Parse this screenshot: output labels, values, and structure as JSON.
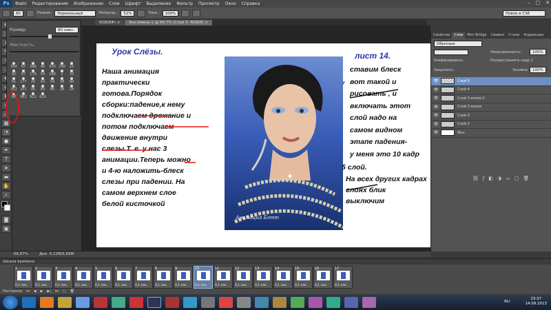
{
  "menubar": {
    "logo": "Ps",
    "items": [
      "Файл",
      "Редактирование",
      "Изображение",
      "Слои",
      "Шрифт",
      "Выделение",
      "Фильтр",
      "Просмотр",
      "Окно",
      "Справка"
    ],
    "win_controls": [
      "–",
      "□",
      "✕"
    ]
  },
  "optbar": {
    "brush_size": "80",
    "mode_label": "Режим:",
    "mode_value": "Нормальный",
    "opacity_label": "Непрозр.:",
    "opacity_value": "52%",
    "flow_label": "Наж.:",
    "flow_value": "100%",
    "workspace": "Новое в CS6"
  },
  "brush_panel": {
    "size_label": "Размер:",
    "size_value": "80 пикс.",
    "hardness_label": "Жесткость:",
    "presets": [
      "354",
      "67",
      "296",
      "46",
      "429",
      "296",
      "15",
      "92",
      "67",
      "179",
      "54",
      "188",
      "1",
      "10",
      "61",
      "177",
      "20",
      "43",
      "54",
      "38",
      "60",
      "352",
      "101",
      "90",
      "83",
      "80",
      "28",
      "24",
      "80",
      "962",
      "912",
      "619"
    ]
  },
  "doc_tabs": [
    {
      "label": "RGB/8#) ×",
      "active": false
    },
    {
      "label": "Без имени-1 @ 66,7% (Слой 5, RGB/8) ×",
      "active": true
    }
  ],
  "canvas": {
    "title": "Урок Слёзы.",
    "left_text": [
      "Наша анимация",
      "практически",
      "готова.Порядок",
      "сборки:падение,к нему",
      "подключаем дрожание и",
      "потом подключаем",
      "движение внутри",
      "слезы.Т. е. у нас 3",
      "анимации.Теперь можно",
      "и 4-ю наложить-блеск",
      "слезы при падении. На",
      "самом верхнем слое",
      "белой кисточкой"
    ],
    "sheet_label": "лист 14.",
    "right_text": [
      "ставим блеск",
      "вот такой и",
      "рисовать , и",
      "включать этот",
      "слой надо на",
      "самом видном",
      "этапе падения-",
      "у меня это 10 кадр"
    ],
    "right_text_2": "5 слой.",
    "right_text_3": [
      "На всех других  кадрах",
      "слоях блик",
      "выключим"
    ],
    "watermark": "Анимация Бэтт"
  },
  "right_panel": {
    "tabs": [
      "Свойства",
      "Слои",
      "Mini Bridge",
      "Символ",
      "Стили",
      "Коррекция"
    ],
    "blend_mode": "Обычные",
    "opacity_label": "Непрозрачность:",
    "opacity_value": "100%",
    "unify_label": "Унифицировать:",
    "propagate_label": "Распространить кадр 1",
    "lock_label": "Закрепить:",
    "fill_label": "Заливка:",
    "fill_value": "100%",
    "layers": [
      {
        "name": "Слой 5",
        "selected": true
      },
      {
        "name": "Слой 4",
        "selected": false
      },
      {
        "name": "Слой 3 копия 2",
        "selected": false
      },
      {
        "name": "Слой 3 копия",
        "selected": false
      },
      {
        "name": "Слой 3",
        "selected": false
      },
      {
        "name": "Слой 2",
        "selected": false
      },
      {
        "name": "Фон",
        "selected": false
      }
    ]
  },
  "status": {
    "zoom": "66,67%",
    "doc_size": "Док: 4,12M/5,69M"
  },
  "timeline": {
    "title": "Шкала времени",
    "frames": [
      {
        "n": "1",
        "d": "0,1 сек."
      },
      {
        "n": "2",
        "d": "0,1 сек."
      },
      {
        "n": "3",
        "d": "0,1 сек."
      },
      {
        "n": "4",
        "d": "0,1 сек."
      },
      {
        "n": "5",
        "d": "0,1 сек."
      },
      {
        "n": "6",
        "d": "0,1 сек."
      },
      {
        "n": "7",
        "d": "0,1 сек."
      },
      {
        "n": "8",
        "d": "0,1 сек."
      },
      {
        "n": "9",
        "d": "0,1 сек."
      },
      {
        "n": "10",
        "d": "0,1 сек."
      },
      {
        "n": "11",
        "d": "0,1 сек."
      },
      {
        "n": "12",
        "d": "0,1 сек."
      },
      {
        "n": "13",
        "d": "0,1 сек."
      },
      {
        "n": "14",
        "d": "0,1 сек."
      },
      {
        "n": "15",
        "d": "0,1 сек."
      },
      {
        "n": "16",
        "d": "0,1 сек."
      },
      {
        "n": "17",
        "d": "0,1 сек."
      }
    ],
    "selected_frame": "10",
    "loop": "Постоянно"
  },
  "taskbar": {
    "lang": "RU",
    "time": "23:37",
    "date": "14.09.2013"
  }
}
